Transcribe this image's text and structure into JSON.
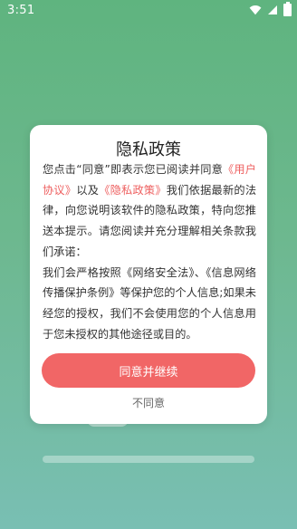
{
  "status_bar": {
    "time": "3:51"
  },
  "dialog": {
    "title": "隐私政策",
    "body_part1": "您点击“同意”即表示您已阅读并同意",
    "user_agreement_link": "《用户协议》",
    "body_part2": "以及",
    "privacy_policy_link": "《隐私政策》",
    "body_part3": "我们依据最新的法律，向您说明该软件的隐私政策，特向您推送本提示。请您阅读并充分理解相关条款我们承诺：",
    "body_part4": "我们会严格按照《网络安全法》、《信息网络传播保护条例》等保护您的个人信息;如果未经您的授权，我们不会使用您的个人信息用于您未授权的其他途径或目的。",
    "agree_label": "同意并继续",
    "disagree_label": "不同意"
  },
  "colors": {
    "accent": "#f16666",
    "link": "#ee5f5f",
    "background_top": "#5fb47f",
    "background_bottom": "#79bfb3"
  },
  "icons": [
    "wifi-icon",
    "signal-icon",
    "battery-icon"
  ]
}
